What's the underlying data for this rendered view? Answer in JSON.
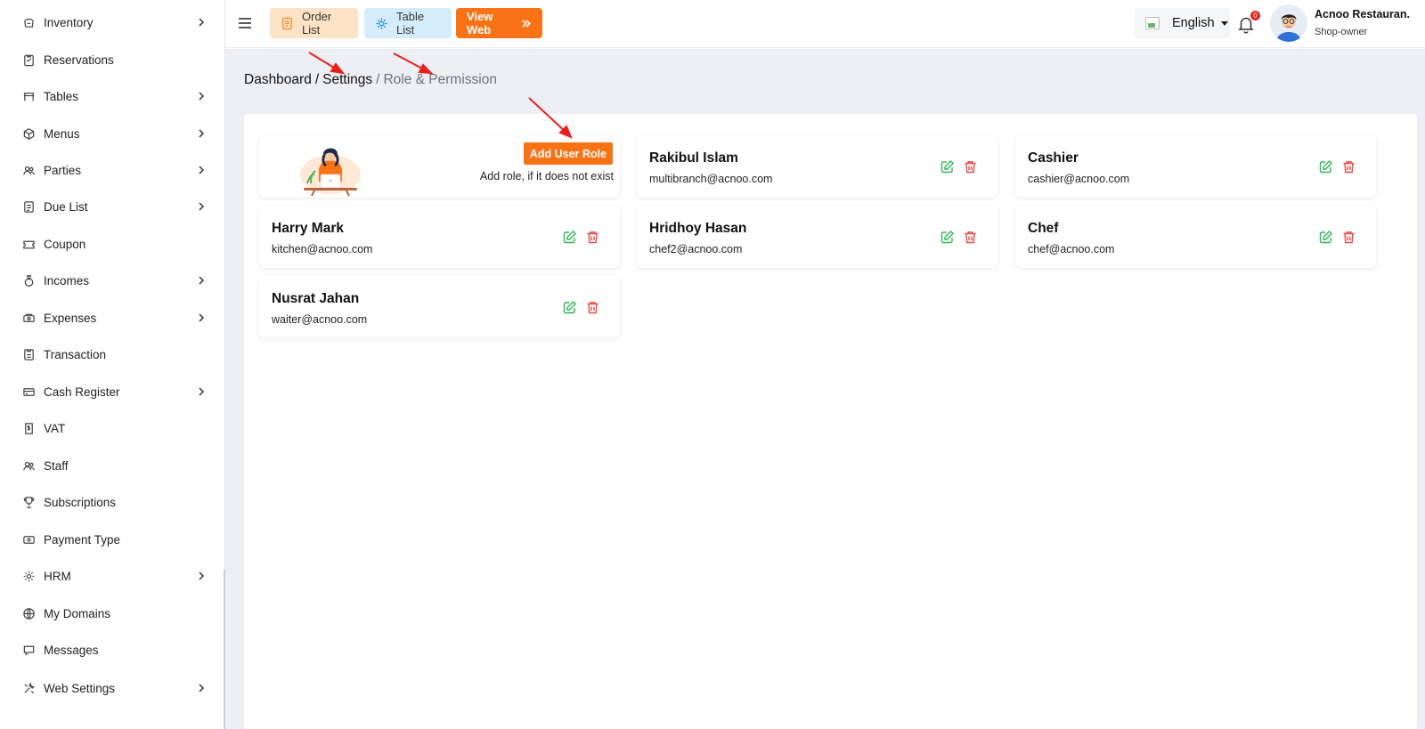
{
  "sidebar": {
    "items": [
      {
        "label": "Inventory",
        "icon": "inventory-icon",
        "has_submenu": true
      },
      {
        "label": "Reservations",
        "icon": "reservations-icon",
        "has_submenu": false
      },
      {
        "label": "Tables",
        "icon": "tables-icon",
        "has_submenu": true
      },
      {
        "label": "Menus",
        "icon": "menus-icon",
        "has_submenu": true
      },
      {
        "label": "Parties",
        "icon": "parties-icon",
        "has_submenu": true
      },
      {
        "label": "Due List",
        "icon": "due-list-icon",
        "has_submenu": true
      },
      {
        "label": "Coupon",
        "icon": "coupon-icon",
        "has_submenu": false
      },
      {
        "label": "Incomes",
        "icon": "incomes-icon",
        "has_submenu": true
      },
      {
        "label": "Expenses",
        "icon": "expenses-icon",
        "has_submenu": true
      },
      {
        "label": "Transaction",
        "icon": "transaction-icon",
        "has_submenu": false
      },
      {
        "label": "Cash Register",
        "icon": "cash-register-icon",
        "has_submenu": true
      },
      {
        "label": "VAT",
        "icon": "vat-icon",
        "has_submenu": false
      },
      {
        "label": "Staff",
        "icon": "staff-icon",
        "has_submenu": false
      },
      {
        "label": "Subscriptions",
        "icon": "subscriptions-icon",
        "has_submenu": false
      },
      {
        "label": "Payment Type",
        "icon": "payment-type-icon",
        "has_submenu": false
      },
      {
        "label": "HRM",
        "icon": "hrm-icon",
        "has_submenu": true
      },
      {
        "label": "My Domains",
        "icon": "domains-icon",
        "has_submenu": false
      },
      {
        "label": "Messages",
        "icon": "messages-icon",
        "has_submenu": false
      },
      {
        "label": "Web Settings",
        "icon": "web-settings-icon",
        "has_submenu": true
      }
    ]
  },
  "topbar": {
    "order_list": "Order List",
    "table_list": "Table List",
    "view_web": "View Web",
    "language": "English",
    "notification_count": "0",
    "user_name": "Acnoo Restauran.",
    "user_role": "Shop-owner"
  },
  "breadcrumb": {
    "dashboard": "Dashboard",
    "separator": "/",
    "settings": "Settings",
    "current": "Role & Permission"
  },
  "add_role": {
    "button": "Add User Role",
    "hint": "Add role, if it does not exist"
  },
  "roles": [
    {
      "name": "Rakibul Islam",
      "email": "multibranch@acnoo.com"
    },
    {
      "name": "Cashier",
      "email": "cashier@acnoo.com"
    },
    {
      "name": "Harry Mark",
      "email": "kitchen@acnoo.com"
    },
    {
      "name": "Hridhoy Hasan",
      "email": "chef2@acnoo.com"
    },
    {
      "name": "Chef",
      "email": "chef@acnoo.com"
    },
    {
      "name": "Nusrat Jahan",
      "email": "waiter@acnoo.com"
    }
  ],
  "colors": {
    "accent": "#f97316",
    "edit": "#2fb458",
    "delete": "#e84a4a",
    "annotation_arrow": "#e8201c"
  }
}
